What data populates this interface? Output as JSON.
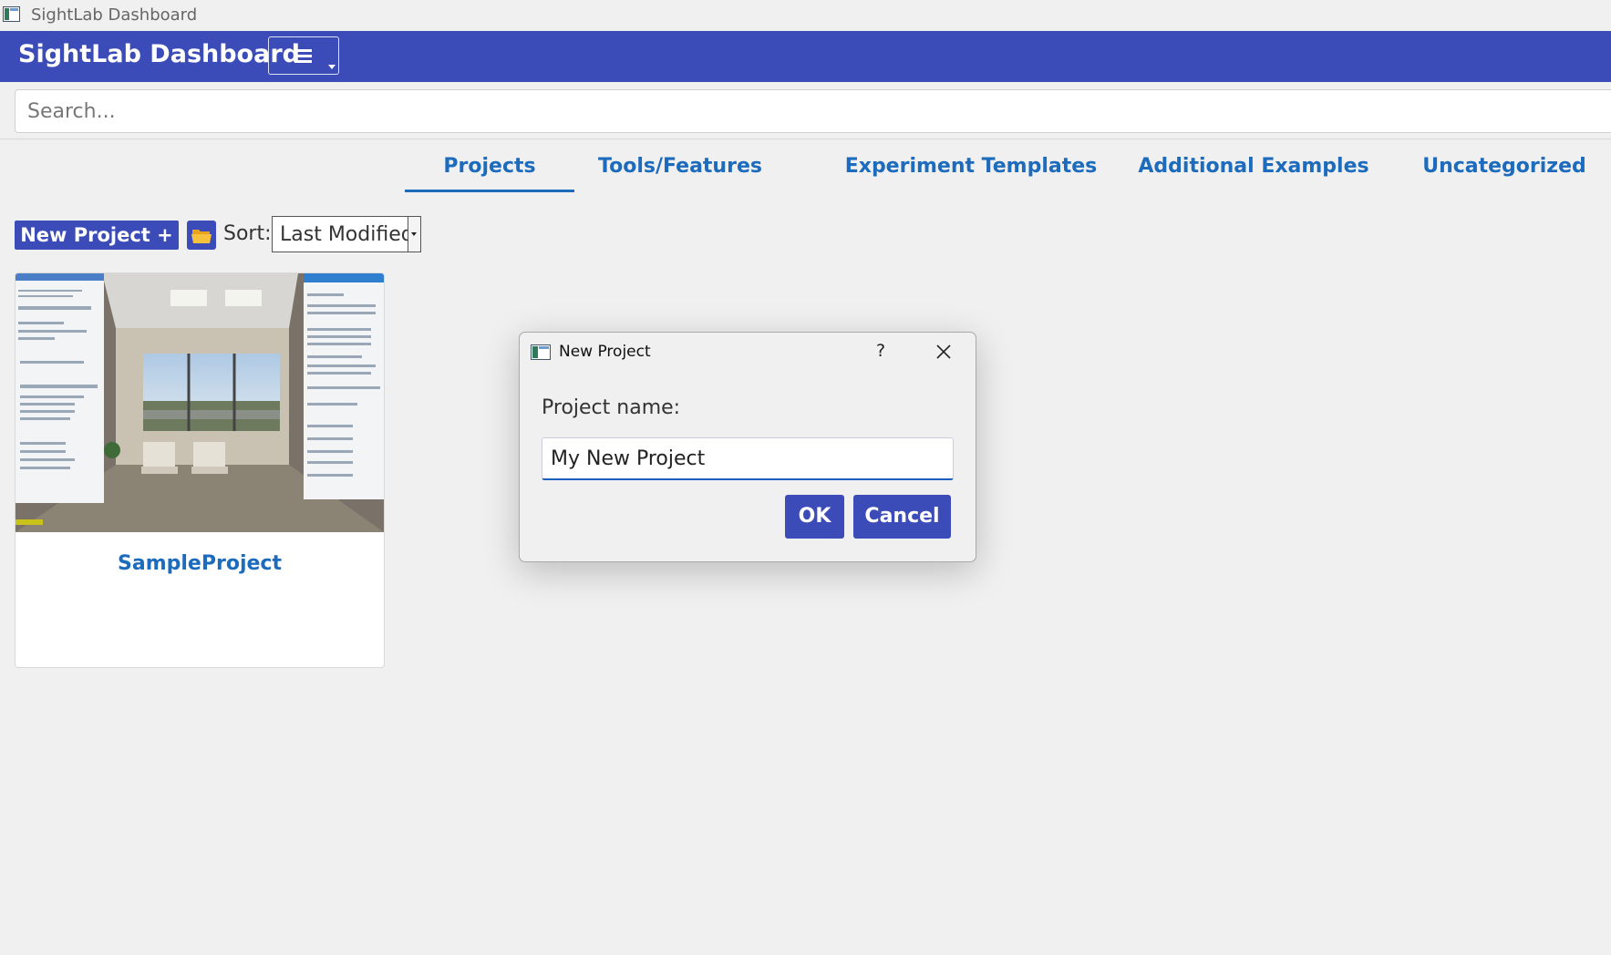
{
  "window": {
    "title": "SightLab Dashboard"
  },
  "header": {
    "title": "SightLab Dashboard"
  },
  "search": {
    "placeholder": "Search..."
  },
  "tabs": [
    {
      "label": "Projects",
      "active": true
    },
    {
      "label": "Tools/Features"
    },
    {
      "label": "Experiment Templates"
    },
    {
      "label": "Additional Examples"
    },
    {
      "label": "Uncategorized"
    }
  ],
  "toolbar": {
    "new_project_label": "New Project +",
    "sort_label": "Sort:",
    "sort_value": "Last Modified"
  },
  "projects": [
    {
      "name": "SampleProject"
    }
  ],
  "dialog": {
    "title": "New Project",
    "help": "?",
    "label": "Project name:",
    "input_value": "My New Project",
    "ok_label": "OK",
    "cancel_label": "Cancel"
  },
  "colors": {
    "accent": "#3b4cb8",
    "link": "#1c6bbd",
    "background": "#f0f0f0"
  }
}
